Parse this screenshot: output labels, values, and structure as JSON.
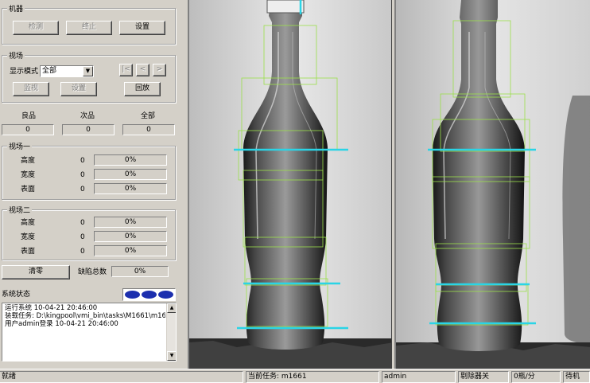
{
  "machine": {
    "title": "机器",
    "detect_label": "检测",
    "stop_label": "终止",
    "settings_label": "设置"
  },
  "viewfield": {
    "title": "视场",
    "display_mode_label": "显示模式",
    "display_mode_value": "全部",
    "nav_first": "|<",
    "nav_prev": "<",
    "nav_next": ">",
    "monitor_label": "监视",
    "settings_label": "设置",
    "playback_label": "回放"
  },
  "counts": {
    "good_label": "良品",
    "good_value": "0",
    "defect_label": "次品",
    "defect_value": "0",
    "total_label": "全部",
    "total_value": "0"
  },
  "field1": {
    "title": "视场一",
    "rows": [
      {
        "label": "高度",
        "count": "0",
        "percent": "0%"
      },
      {
        "label": "宽度",
        "count": "0",
        "percent": "0%"
      },
      {
        "label": "表面",
        "count": "0",
        "percent": "0%"
      }
    ]
  },
  "field2": {
    "title": "视场二",
    "rows": [
      {
        "label": "高度",
        "count": "0",
        "percent": "0%"
      },
      {
        "label": "宽度",
        "count": "0",
        "percent": "0%"
      },
      {
        "label": "表面",
        "count": "0",
        "percent": "0%"
      }
    ]
  },
  "reset_label": "清零",
  "defect_total_label": "缺陷总数",
  "defect_total_value": "0%",
  "system_status_label": "系统状态",
  "log_lines": [
    "运行系统 10-04-21 20:46:00",
    "装载任务: D:\\kingpool\\vmi_bin\\tasks\\M1661\\m1661.cod",
    "用户admin登录  10-04-21 20:46:00"
  ],
  "statusbar": {
    "ready": "就绪",
    "current_task": "当前任务: m1661",
    "user": "admin",
    "rejector": "剔除器关",
    "rate": "0瓶/分",
    "state": "待机"
  },
  "colors": {
    "overlay_green": "#9be04a",
    "overlay_cyan": "#2ad4e6",
    "status_blue": "#1c2fae"
  }
}
